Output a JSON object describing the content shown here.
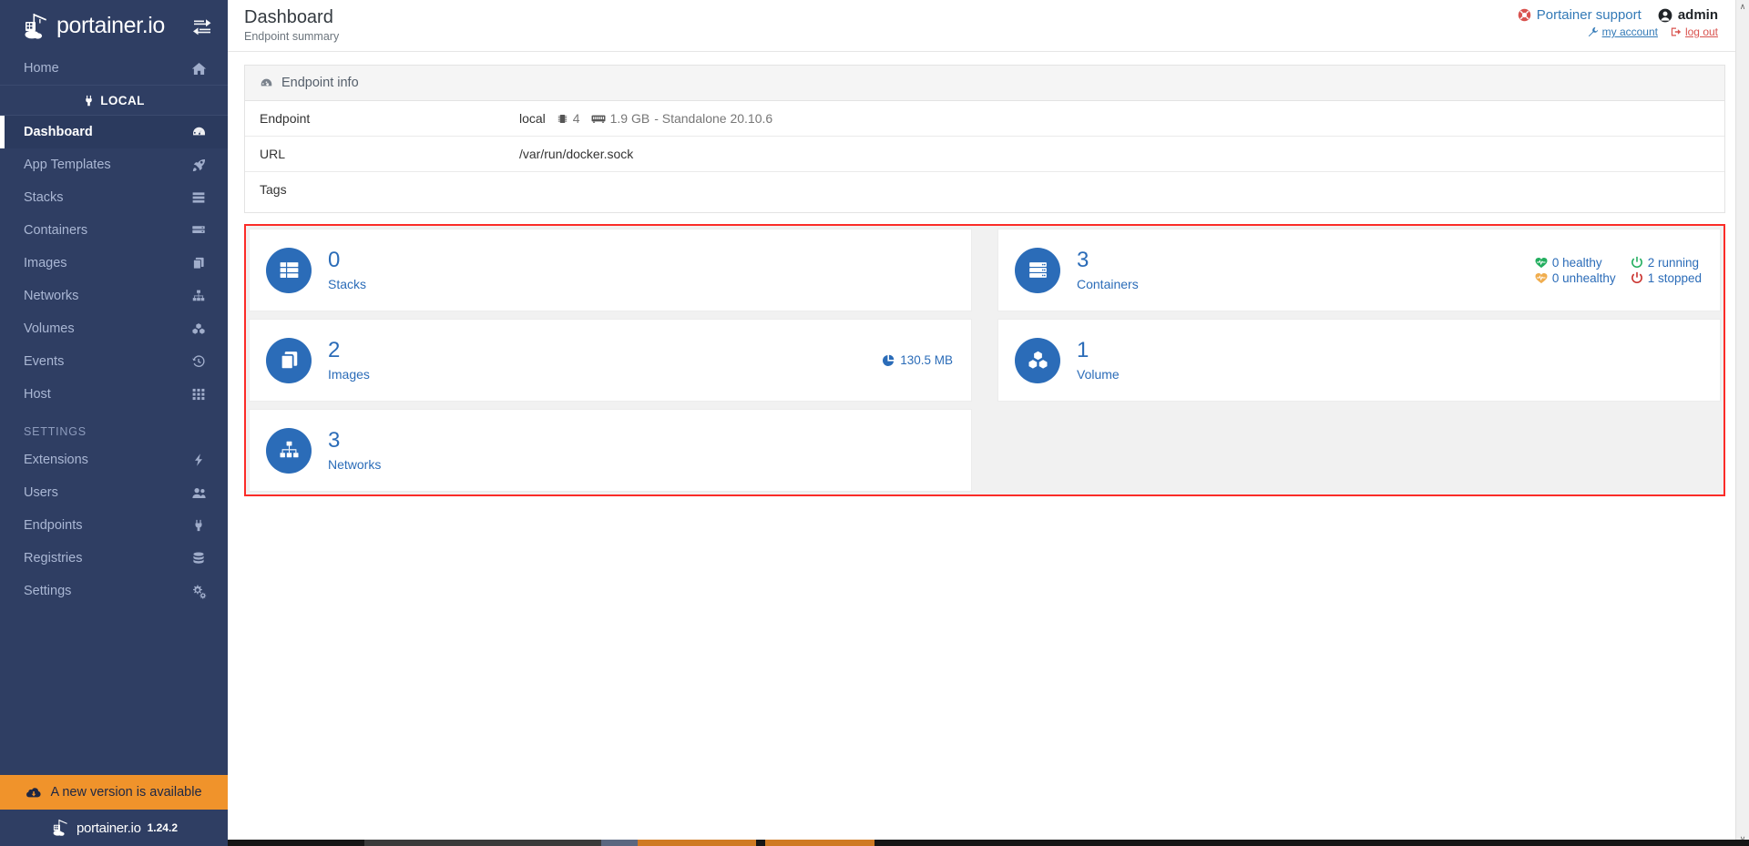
{
  "sidebar": {
    "brand": "portainer.io",
    "toggle_icon": "collapse-sidebar-icon",
    "home": {
      "label": "Home",
      "icon": "home-icon"
    },
    "local_section": {
      "label": "LOCAL",
      "icon": "plug-icon"
    },
    "items": [
      {
        "label": "Dashboard",
        "icon": "dashboard-icon",
        "active": true
      },
      {
        "label": "App Templates",
        "icon": "rocket-icon",
        "active": false
      },
      {
        "label": "Stacks",
        "icon": "stacks-icon",
        "active": false
      },
      {
        "label": "Containers",
        "icon": "containers-icon",
        "active": false
      },
      {
        "label": "Images",
        "icon": "images-icon",
        "active": false
      },
      {
        "label": "Networks",
        "icon": "networks-icon",
        "active": false
      },
      {
        "label": "Volumes",
        "icon": "volumes-icon",
        "active": false
      },
      {
        "label": "Events",
        "icon": "history-icon",
        "active": false
      },
      {
        "label": "Host",
        "icon": "host-icon",
        "active": false
      }
    ],
    "settings_heading": "SETTINGS",
    "settings_items": [
      {
        "label": "Extensions",
        "icon": "bolt-icon"
      },
      {
        "label": "Users",
        "icon": "users-icon"
      },
      {
        "label": "Endpoints",
        "icon": "plug-icon"
      },
      {
        "label": "Registries",
        "icon": "database-icon"
      },
      {
        "label": "Settings",
        "icon": "gears-icon"
      }
    ],
    "update_banner": {
      "label": "A new version is available",
      "icon": "cloud-download-icon",
      "color": "#f0932b"
    },
    "footer": {
      "brand": "portainer.io",
      "version": "1.24.2"
    }
  },
  "header": {
    "title": "Dashboard",
    "subtitle": "Endpoint summary",
    "support_label": "Portainer support",
    "support_icon": "lifebuoy-icon",
    "user_name": "admin",
    "user_icon": "user-circle-icon",
    "my_account_label": "my account",
    "my_account_icon": "wrench-icon",
    "logout_label": "log out",
    "logout_icon": "sign-out-icon"
  },
  "endpoint_info": {
    "panel_title": "Endpoint info",
    "panel_icon": "tachometer-icon",
    "rows": [
      {
        "key": "Endpoint",
        "value": "local",
        "cpu_icon": "microchip-icon",
        "cpu": "4",
        "memory_icon": "memory-icon",
        "memory": "1.9 GB",
        "suffix": "- Standalone 20.10.6"
      },
      {
        "key": "URL",
        "value": "/var/run/docker.sock"
      },
      {
        "key": "Tags",
        "value": ""
      }
    ]
  },
  "widgets": {
    "accent_color": "#2b6cb8",
    "highlight_color": "#fb2c28",
    "items": [
      {
        "count": "0",
        "label": "Stacks",
        "icon": "stacks-icon"
      },
      {
        "count": "3",
        "label": "Containers",
        "icon": "containers-icon",
        "stats": [
          {
            "text": "0 healthy",
            "icon": "heartbeat-icon",
            "color": "#23ae5f"
          },
          {
            "text": "2 running",
            "icon": "power-icon",
            "color": "#23ae5f"
          },
          {
            "text": "0 unhealthy",
            "icon": "heartbeat-icon",
            "color": "#f0ad4e"
          },
          {
            "text": "1 stopped",
            "icon": "power-icon",
            "color": "#c9302c"
          }
        ]
      },
      {
        "count": "2",
        "label": "Images",
        "icon": "images-icon",
        "size": "130.5 MB",
        "size_icon": "pie-chart-icon"
      },
      {
        "count": "1",
        "label": "Volume",
        "icon": "volumes-icon"
      },
      {
        "count": "3",
        "label": "Networks",
        "icon": "networks-icon"
      }
    ]
  },
  "scrollbar": {
    "up_arrow": "∧",
    "down_arrow": "∨"
  }
}
